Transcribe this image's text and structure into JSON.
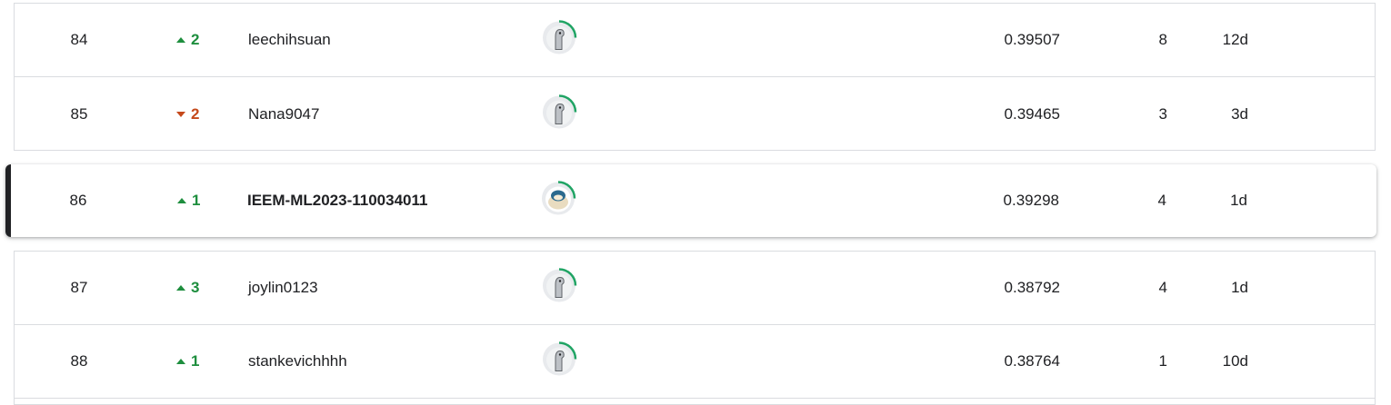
{
  "rows_top": [
    {
      "rank": "84",
      "delta": "2",
      "dir": "up",
      "name": "leechihsuan",
      "score": "0.39507",
      "entries": "8",
      "last": "12d"
    },
    {
      "rank": "85",
      "delta": "2",
      "dir": "down",
      "name": "Nana9047",
      "score": "0.39465",
      "entries": "3",
      "last": "3d"
    }
  ],
  "highlight": {
    "rank": "86",
    "delta": "1",
    "dir": "up",
    "name": "IEEM-ML2023-110034011",
    "score": "0.39298",
    "entries": "4",
    "last": "1d"
  },
  "rows_bottom": [
    {
      "rank": "87",
      "delta": "3",
      "dir": "up",
      "name": "joylin0123",
      "score": "0.38792",
      "entries": "4",
      "last": "1d"
    },
    {
      "rank": "88",
      "delta": "1",
      "dir": "up",
      "name": "stankevichhhh",
      "score": "0.38764",
      "entries": "1",
      "last": "10d"
    }
  ],
  "icons": {
    "avatar_default": "bird-avatar-icon",
    "avatar_highlight": "snorlax-avatar-icon",
    "rank_up": "triangle-up-icon",
    "rank_down": "triangle-down-icon"
  },
  "colors": {
    "up": "#1e8e3e",
    "down": "#c5491b",
    "progress_ring": "#20a464",
    "highlight_bar": "#202124"
  }
}
